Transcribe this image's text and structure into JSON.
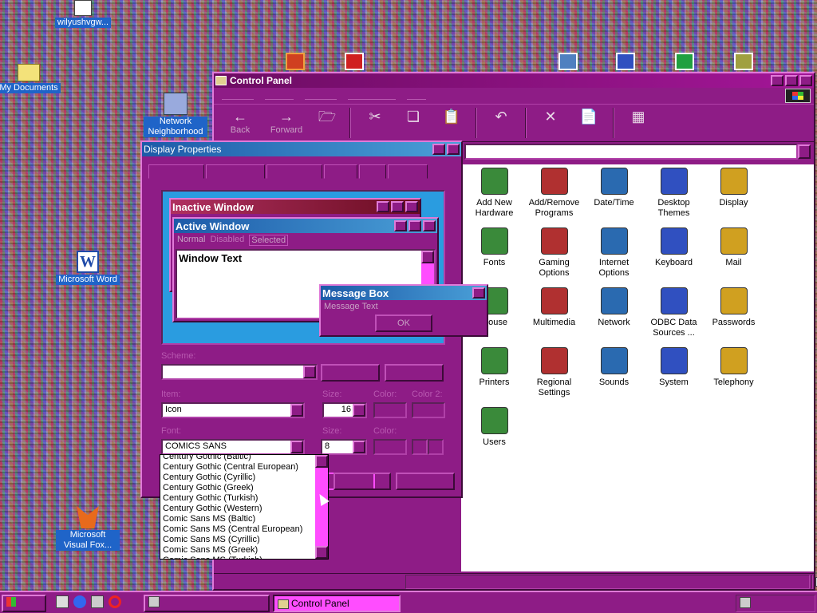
{
  "desktop": {
    "icons": [
      {
        "name": "wilyushvgw-icon",
        "label": "wilyushvgw..."
      },
      {
        "name": "my-documents-icon",
        "label": "My Documents"
      },
      {
        "name": "network-neighborhood-icon",
        "label": "Network Neighborhood"
      },
      {
        "name": "microsoft-word-icon",
        "label": "Microsoft Word"
      },
      {
        "name": "microsoft-visual-fox-icon",
        "label": "Microsoft Visual Fox..."
      }
    ]
  },
  "control_panel": {
    "title": "Control Panel",
    "toolbar": {
      "back": "Back",
      "forward": "Forward"
    },
    "items": [
      {
        "label": "Add New Hardware",
        "icon": "hardware-icon"
      },
      {
        "label": "Add/Remove Programs",
        "icon": "programs-icon"
      },
      {
        "label": "Date/Time",
        "icon": "clock-icon"
      },
      {
        "label": "Desktop Themes",
        "icon": "themes-icon"
      },
      {
        "label": "Display",
        "icon": "monitor-icon"
      },
      {
        "label": "Fonts",
        "icon": "fonts-icon"
      },
      {
        "label": "Gaming Options",
        "icon": "joystick-icon"
      },
      {
        "label": "Internet Options",
        "icon": "globe-icon"
      },
      {
        "label": "Keyboard",
        "icon": "keyboard-icon"
      },
      {
        "label": "Mail",
        "icon": "mail-icon"
      },
      {
        "label": "Mouse",
        "icon": "mouse-icon"
      },
      {
        "label": "Multimedia",
        "icon": "multimedia-icon"
      },
      {
        "label": "Network",
        "icon": "network-icon"
      },
      {
        "label": "ODBC Data Sources ...",
        "icon": "odbc-icon"
      },
      {
        "label": "Passwords",
        "icon": "keys-icon"
      },
      {
        "label": "Printers",
        "icon": "printer-icon"
      },
      {
        "label": "Regional Settings",
        "icon": "globe-icon"
      },
      {
        "label": "Sounds",
        "icon": "speaker-icon"
      },
      {
        "label": "System",
        "icon": "computer-icon"
      },
      {
        "label": "Telephony",
        "icon": "telephone-icon"
      },
      {
        "label": "Users",
        "icon": "users-icon"
      }
    ]
  },
  "display_properties": {
    "title": "Display Properties",
    "preview": {
      "inactive_title": "Inactive Window",
      "active_title": "Active Window",
      "menu_normal": "Normal",
      "menu_disabled": "Disabled",
      "menu_selected": "Selected",
      "window_text": "Window Text",
      "message_box_title": "Message Box",
      "message_text": "Message Text",
      "ok": "OK"
    },
    "labels": {
      "scheme": "Scheme:",
      "item": "Item:",
      "size": "Size:",
      "color": "Color:",
      "color2": "Color 2:",
      "font": "Font:",
      "font_size": "Size:",
      "font_color": "Color:"
    },
    "values": {
      "item": "Icon",
      "size": "16",
      "font": "COMICS SANS",
      "font_size": "8"
    },
    "font_options": [
      "Century Gothic (Baltic)",
      "Century Gothic (Central European)",
      "Century Gothic (Cyrillic)",
      "Century Gothic (Greek)",
      "Century Gothic (Turkish)",
      "Century Gothic (Western)",
      "Comic Sans MS (Baltic)",
      "Comic Sans MS (Central European)",
      "Comic Sans MS (Cyrillic)",
      "Comic Sans MS (Greek)",
      "Comic Sans MS (Turkish)"
    ]
  },
  "taskbar": {
    "control_panel": "Control Panel"
  }
}
